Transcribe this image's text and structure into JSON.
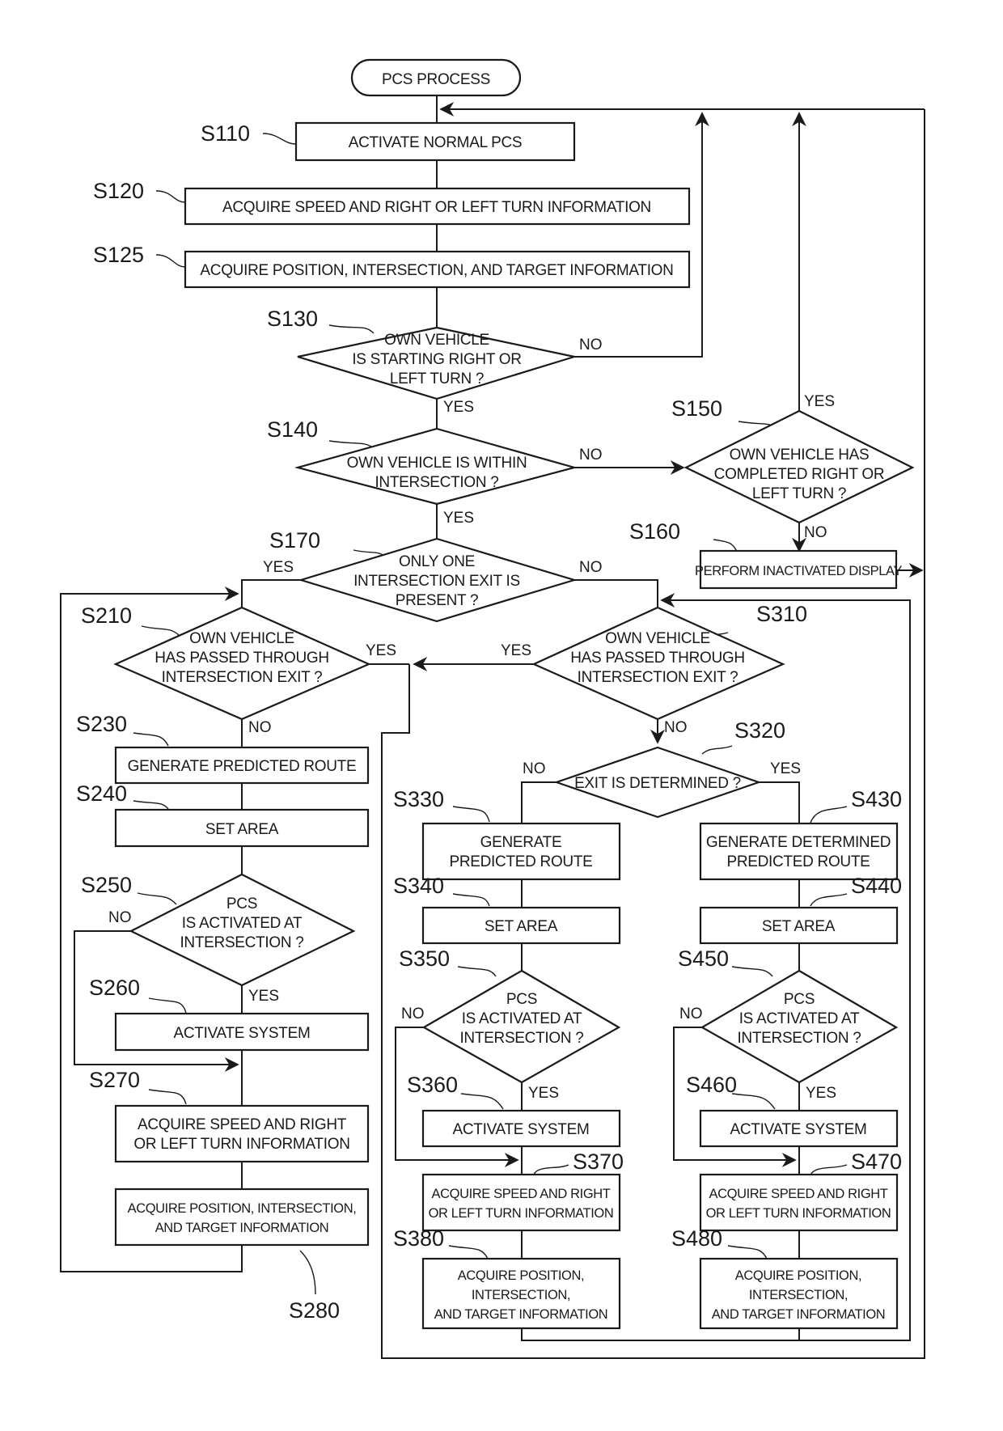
{
  "title": "PCS PROCESS",
  "nodes": {
    "S110": {
      "step": "S110",
      "lines": [
        "ACTIVATE NORMAL PCS"
      ]
    },
    "S120": {
      "step": "S120",
      "lines": [
        "ACQUIRE SPEED AND RIGHT OR LEFT TURN INFORMATION"
      ]
    },
    "S125": {
      "step": "S125",
      "lines": [
        "ACQUIRE POSITION, INTERSECTION, AND TARGET INFORMATION"
      ]
    },
    "S130": {
      "step": "S130",
      "lines": [
        "OWN VEHICLE",
        "IS STARTING RIGHT OR",
        "LEFT TURN ?"
      ]
    },
    "S140": {
      "step": "S140",
      "lines": [
        "OWN VEHICLE IS WITHIN",
        "INTERSECTION ?"
      ]
    },
    "S150": {
      "step": "S150",
      "lines": [
        "OWN VEHICLE HAS",
        "COMPLETED RIGHT OR",
        "LEFT TURN ?"
      ]
    },
    "S160": {
      "step": "S160",
      "lines": [
        "PERFORM INACTIVATED DISPLAY"
      ]
    },
    "S170": {
      "step": "S170",
      "lines": [
        "ONLY ONE",
        "INTERSECTION EXIT IS",
        "PRESENT ?"
      ]
    },
    "S210": {
      "step": "S210",
      "lines": [
        "OWN VEHICLE",
        "HAS PASSED THROUGH",
        "INTERSECTION EXIT ?"
      ]
    },
    "S230": {
      "step": "S230",
      "lines": [
        "GENERATE PREDICTED ROUTE"
      ]
    },
    "S240": {
      "step": "S240",
      "lines": [
        "SET AREA"
      ]
    },
    "S250": {
      "step": "S250",
      "lines": [
        "PCS",
        "IS ACTIVATED AT",
        "INTERSECTION ?"
      ]
    },
    "S260": {
      "step": "S260",
      "lines": [
        "ACTIVATE SYSTEM"
      ]
    },
    "S270": {
      "step": "S270",
      "lines": [
        "ACQUIRE SPEED AND RIGHT",
        "OR LEFT TURN INFORMATION"
      ]
    },
    "S280": {
      "step": "S280",
      "lines": [
        "ACQUIRE POSITION, INTERSECTION,",
        "AND TARGET INFORMATION"
      ]
    },
    "S310": {
      "step": "S310",
      "lines": [
        "OWN VEHICLE",
        "HAS PASSED THROUGH",
        "INTERSECTION EXIT ?"
      ]
    },
    "S320": {
      "step": "S320",
      "lines": [
        "EXIT IS DETERMINED ?"
      ]
    },
    "S330": {
      "step": "S330",
      "lines": [
        "GENERATE",
        "PREDICTED ROUTE"
      ]
    },
    "S340": {
      "step": "S340",
      "lines": [
        "SET AREA"
      ]
    },
    "S350": {
      "step": "S350",
      "lines": [
        "PCS",
        "IS ACTIVATED AT",
        "INTERSECTION ?"
      ]
    },
    "S360": {
      "step": "S360",
      "lines": [
        "ACTIVATE SYSTEM"
      ]
    },
    "S370": {
      "step": "S370",
      "lines": [
        "ACQUIRE SPEED AND RIGHT",
        "OR LEFT TURN INFORMATION"
      ]
    },
    "S380": {
      "step": "S380",
      "lines": [
        "ACQUIRE POSITION,",
        "INTERSECTION,",
        "AND TARGET INFORMATION"
      ]
    },
    "S430": {
      "step": "S430",
      "lines": [
        "GENERATE DETERMINED",
        "PREDICTED ROUTE"
      ]
    },
    "S440": {
      "step": "S440",
      "lines": [
        "SET AREA"
      ]
    },
    "S450": {
      "step": "S450",
      "lines": [
        "PCS",
        "IS ACTIVATED AT",
        "INTERSECTION ?"
      ]
    },
    "S460": {
      "step": "S460",
      "lines": [
        "ACTIVATE SYSTEM"
      ]
    },
    "S470": {
      "step": "S470",
      "lines": [
        "ACQUIRE SPEED AND RIGHT",
        "OR LEFT TURN INFORMATION"
      ]
    },
    "S480": {
      "step": "S480",
      "lines": [
        "ACQUIRE POSITION,",
        "INTERSECTION,",
        "AND TARGET INFORMATION"
      ]
    }
  },
  "branch_labels": {
    "yes": "YES",
    "no": "NO"
  },
  "edges": [
    {
      "from": "start",
      "to": "S110"
    },
    {
      "from": "S110",
      "to": "S120"
    },
    {
      "from": "S120",
      "to": "S125"
    },
    {
      "from": "S125",
      "to": "S130"
    },
    {
      "from": "S130",
      "to": "S140",
      "label": "YES"
    },
    {
      "from": "S130",
      "to": "S110",
      "label": "NO"
    },
    {
      "from": "S140",
      "to": "S170",
      "label": "YES"
    },
    {
      "from": "S140",
      "to": "S150",
      "label": "NO"
    },
    {
      "from": "S150",
      "to": "S110",
      "label": "YES"
    },
    {
      "from": "S150",
      "to": "S160",
      "label": "NO"
    },
    {
      "from": "S160",
      "to": "S110"
    },
    {
      "from": "S170",
      "to": "S210",
      "label": "YES"
    },
    {
      "from": "S170",
      "to": "S310",
      "label": "NO"
    },
    {
      "from": "S210",
      "to": "S230",
      "label": "NO"
    },
    {
      "from": "S210",
      "to": "S110",
      "label": "YES"
    },
    {
      "from": "S230",
      "to": "S240"
    },
    {
      "from": "S240",
      "to": "S250"
    },
    {
      "from": "S250",
      "to": "S260",
      "label": "YES"
    },
    {
      "from": "S250",
      "to": "S270",
      "label": "NO"
    },
    {
      "from": "S260",
      "to": "S270"
    },
    {
      "from": "S270",
      "to": "S280"
    },
    {
      "from": "S280",
      "to": "S210"
    },
    {
      "from": "S310",
      "to": "S320",
      "label": "NO"
    },
    {
      "from": "S310",
      "to": "S110",
      "label": "YES"
    },
    {
      "from": "S320",
      "to": "S330",
      "label": "NO"
    },
    {
      "from": "S320",
      "to": "S430",
      "label": "YES"
    },
    {
      "from": "S330",
      "to": "S340"
    },
    {
      "from": "S340",
      "to": "S350"
    },
    {
      "from": "S350",
      "to": "S360",
      "label": "YES"
    },
    {
      "from": "S350",
      "to": "S370",
      "label": "NO"
    },
    {
      "from": "S360",
      "to": "S370"
    },
    {
      "from": "S370",
      "to": "S380"
    },
    {
      "from": "S380",
      "to": "S310"
    },
    {
      "from": "S430",
      "to": "S440"
    },
    {
      "from": "S440",
      "to": "S450"
    },
    {
      "from": "S450",
      "to": "S460",
      "label": "YES"
    },
    {
      "from": "S450",
      "to": "S470",
      "label": "NO"
    },
    {
      "from": "S460",
      "to": "S470"
    },
    {
      "from": "S470",
      "to": "S480"
    },
    {
      "from": "S480",
      "to": "S310"
    }
  ]
}
